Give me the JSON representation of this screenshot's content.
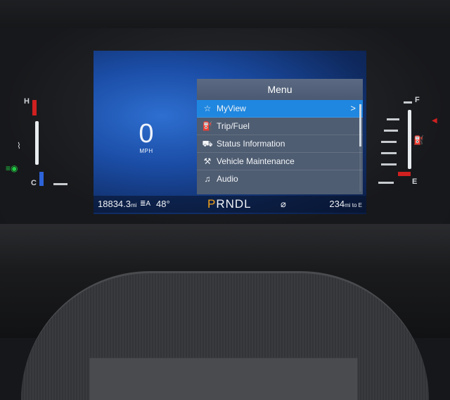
{
  "speedometer": {
    "value": "0",
    "unit": "MPH"
  },
  "menu": {
    "title": "Menu",
    "items": [
      {
        "label": "MyView",
        "icon": "star-icon",
        "glyph": "☆",
        "selected": true
      },
      {
        "label": "Trip/Fuel",
        "icon": "fuel-pump-icon",
        "glyph": "⛽"
      },
      {
        "label": "Status Information",
        "icon": "car-icon",
        "glyph": "⛟"
      },
      {
        "label": "Vehicle Maintenance",
        "icon": "wrench-icon",
        "glyph": "⚒"
      },
      {
        "label": "Audio",
        "icon": "music-note-icon",
        "glyph": "♫"
      }
    ],
    "chevron": ">"
  },
  "status_bar": {
    "odometer": "18834.3",
    "odometer_unit": "mi",
    "lamp_icon": "auto-headlamp-icon",
    "lamp_glyph": "≣A",
    "outside_temp": "48°",
    "gear_active": "P",
    "gear_rest": "RNDL",
    "cruise_icon": "cruise-gauge-icon",
    "cruise_glyph": "⌀",
    "range": "234",
    "range_unit": "mi to E"
  },
  "temp_gauge": {
    "hot": "H",
    "cold": "C"
  },
  "fuel_gauge": {
    "full": "F",
    "empty": "E"
  },
  "colors": {
    "selected": "#1f87e0",
    "gear_active": "#f3a21a",
    "warn_red": "#d02020",
    "cool_blue": "#2d63d8"
  }
}
